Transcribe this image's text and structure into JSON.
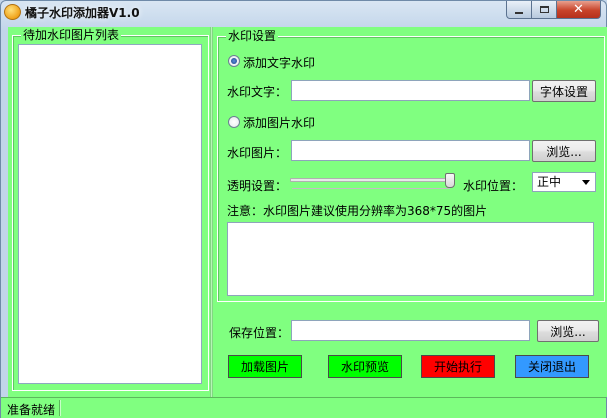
{
  "window": {
    "title": "橘子水印添加器V1.0"
  },
  "left_panel": {
    "title": "待加水印图片列表"
  },
  "settings": {
    "title": "水印设置",
    "text_watermark_option": "添加文字水印",
    "text_label": "水印文字：",
    "text_value": "",
    "font_button": "字体设置",
    "image_watermark_option": "添加图片水印",
    "image_label": "水印图片：",
    "image_value": "",
    "browse_button": "浏览...",
    "opacity_label": "透明设置：",
    "position_label": "水印位置：",
    "position_value": "正中",
    "note": "注意：水印图片建议使用分辨率为368*75的图片",
    "selected_option": "text",
    "opacity_level": 1.0
  },
  "save": {
    "label": "保存位置：",
    "value": "",
    "browse_button": "浏览..."
  },
  "actions": {
    "load": {
      "label": "加载图片",
      "color": "#00ff00"
    },
    "preview": {
      "label": "水印预览",
      "color": "#00ff00"
    },
    "start": {
      "label": "开始执行",
      "color": "#ff0000"
    },
    "close": {
      "label": "关闭退出",
      "color": "#3399ff"
    }
  },
  "status": {
    "text": "准备就绪"
  },
  "colors": {
    "client_background": "#80ff80"
  }
}
